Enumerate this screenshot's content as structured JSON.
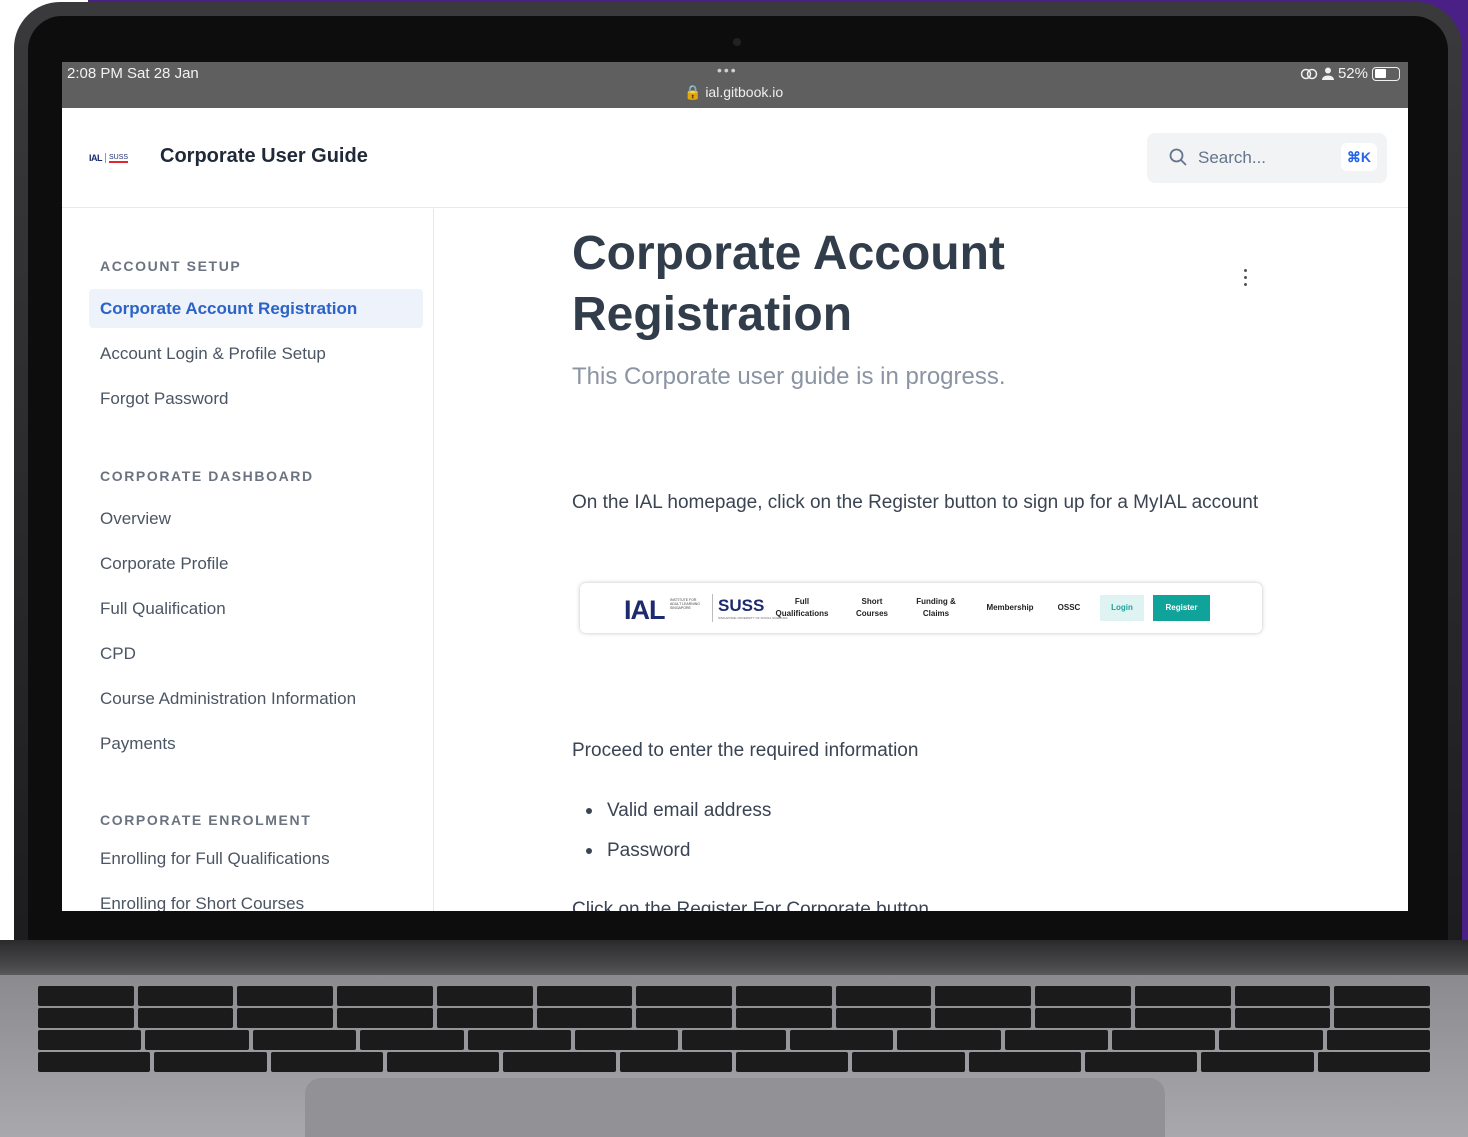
{
  "status_bar": {
    "time": "2:08 PM   Sat 28 Jan",
    "dots": "•••",
    "url": "🔒 ial.gitbook.io",
    "battery_text": "52%",
    "battery_level": 0.52,
    "icons": [
      "link-icon",
      "person-icon",
      "battery-icon"
    ]
  },
  "header": {
    "logo_ial": "IAL",
    "logo_suss": "SUSS",
    "site_title": "Corporate User Guide",
    "search_placeholder": "Search...",
    "search_shortcut": "⌘K"
  },
  "sidebar": {
    "sections": [
      {
        "title": "ACCOUNT SETUP",
        "items": [
          {
            "label": "Corporate Account Registration",
            "active": true
          },
          {
            "label": "Account Login & Profile Setup"
          },
          {
            "label": "Forgot Password"
          }
        ]
      },
      {
        "title": "CORPORATE DASHBOARD",
        "items": [
          {
            "label": "Overview"
          },
          {
            "label": "Corporate Profile"
          },
          {
            "label": "Full Qualification"
          },
          {
            "label": "CPD"
          },
          {
            "label": "Course Administration Information"
          },
          {
            "label": "Payments"
          }
        ]
      },
      {
        "title": "CORPORATE ENROLMENT",
        "items": [
          {
            "label": "Enrolling for Full Qualifications"
          },
          {
            "label": "Enrolling for Short Courses"
          }
        ]
      }
    ]
  },
  "page": {
    "title_line1": "Corporate Account",
    "title_line2": "Registration",
    "subtitle": "This Corporate user guide is in progress.",
    "para1": "On the IAL homepage, click on the Register button to sign up for a MyIAL account",
    "para2": "Proceed to enter the required information",
    "bullets": [
      "Valid email address",
      "Password"
    ],
    "para3": "Click on the Register For Corporate button."
  },
  "ial_nav_image": {
    "brand": "IAL",
    "brand_small": "INSTITUTE FOR ADULT LEARNING SINGAPORE",
    "suss": "SUSS",
    "suss_small": "SINGAPORE UNIVERSITY OF SOCIAL SCIENCES",
    "links": [
      "Full Qualifications",
      "Short Courses",
      "Funding & Claims",
      "Membership",
      "OSSC"
    ],
    "login": "Login",
    "register": "Register"
  },
  "colors": {
    "accent": "#2b63c8",
    "backdrop": "#4a1f86",
    "teal": "#10a39a"
  }
}
